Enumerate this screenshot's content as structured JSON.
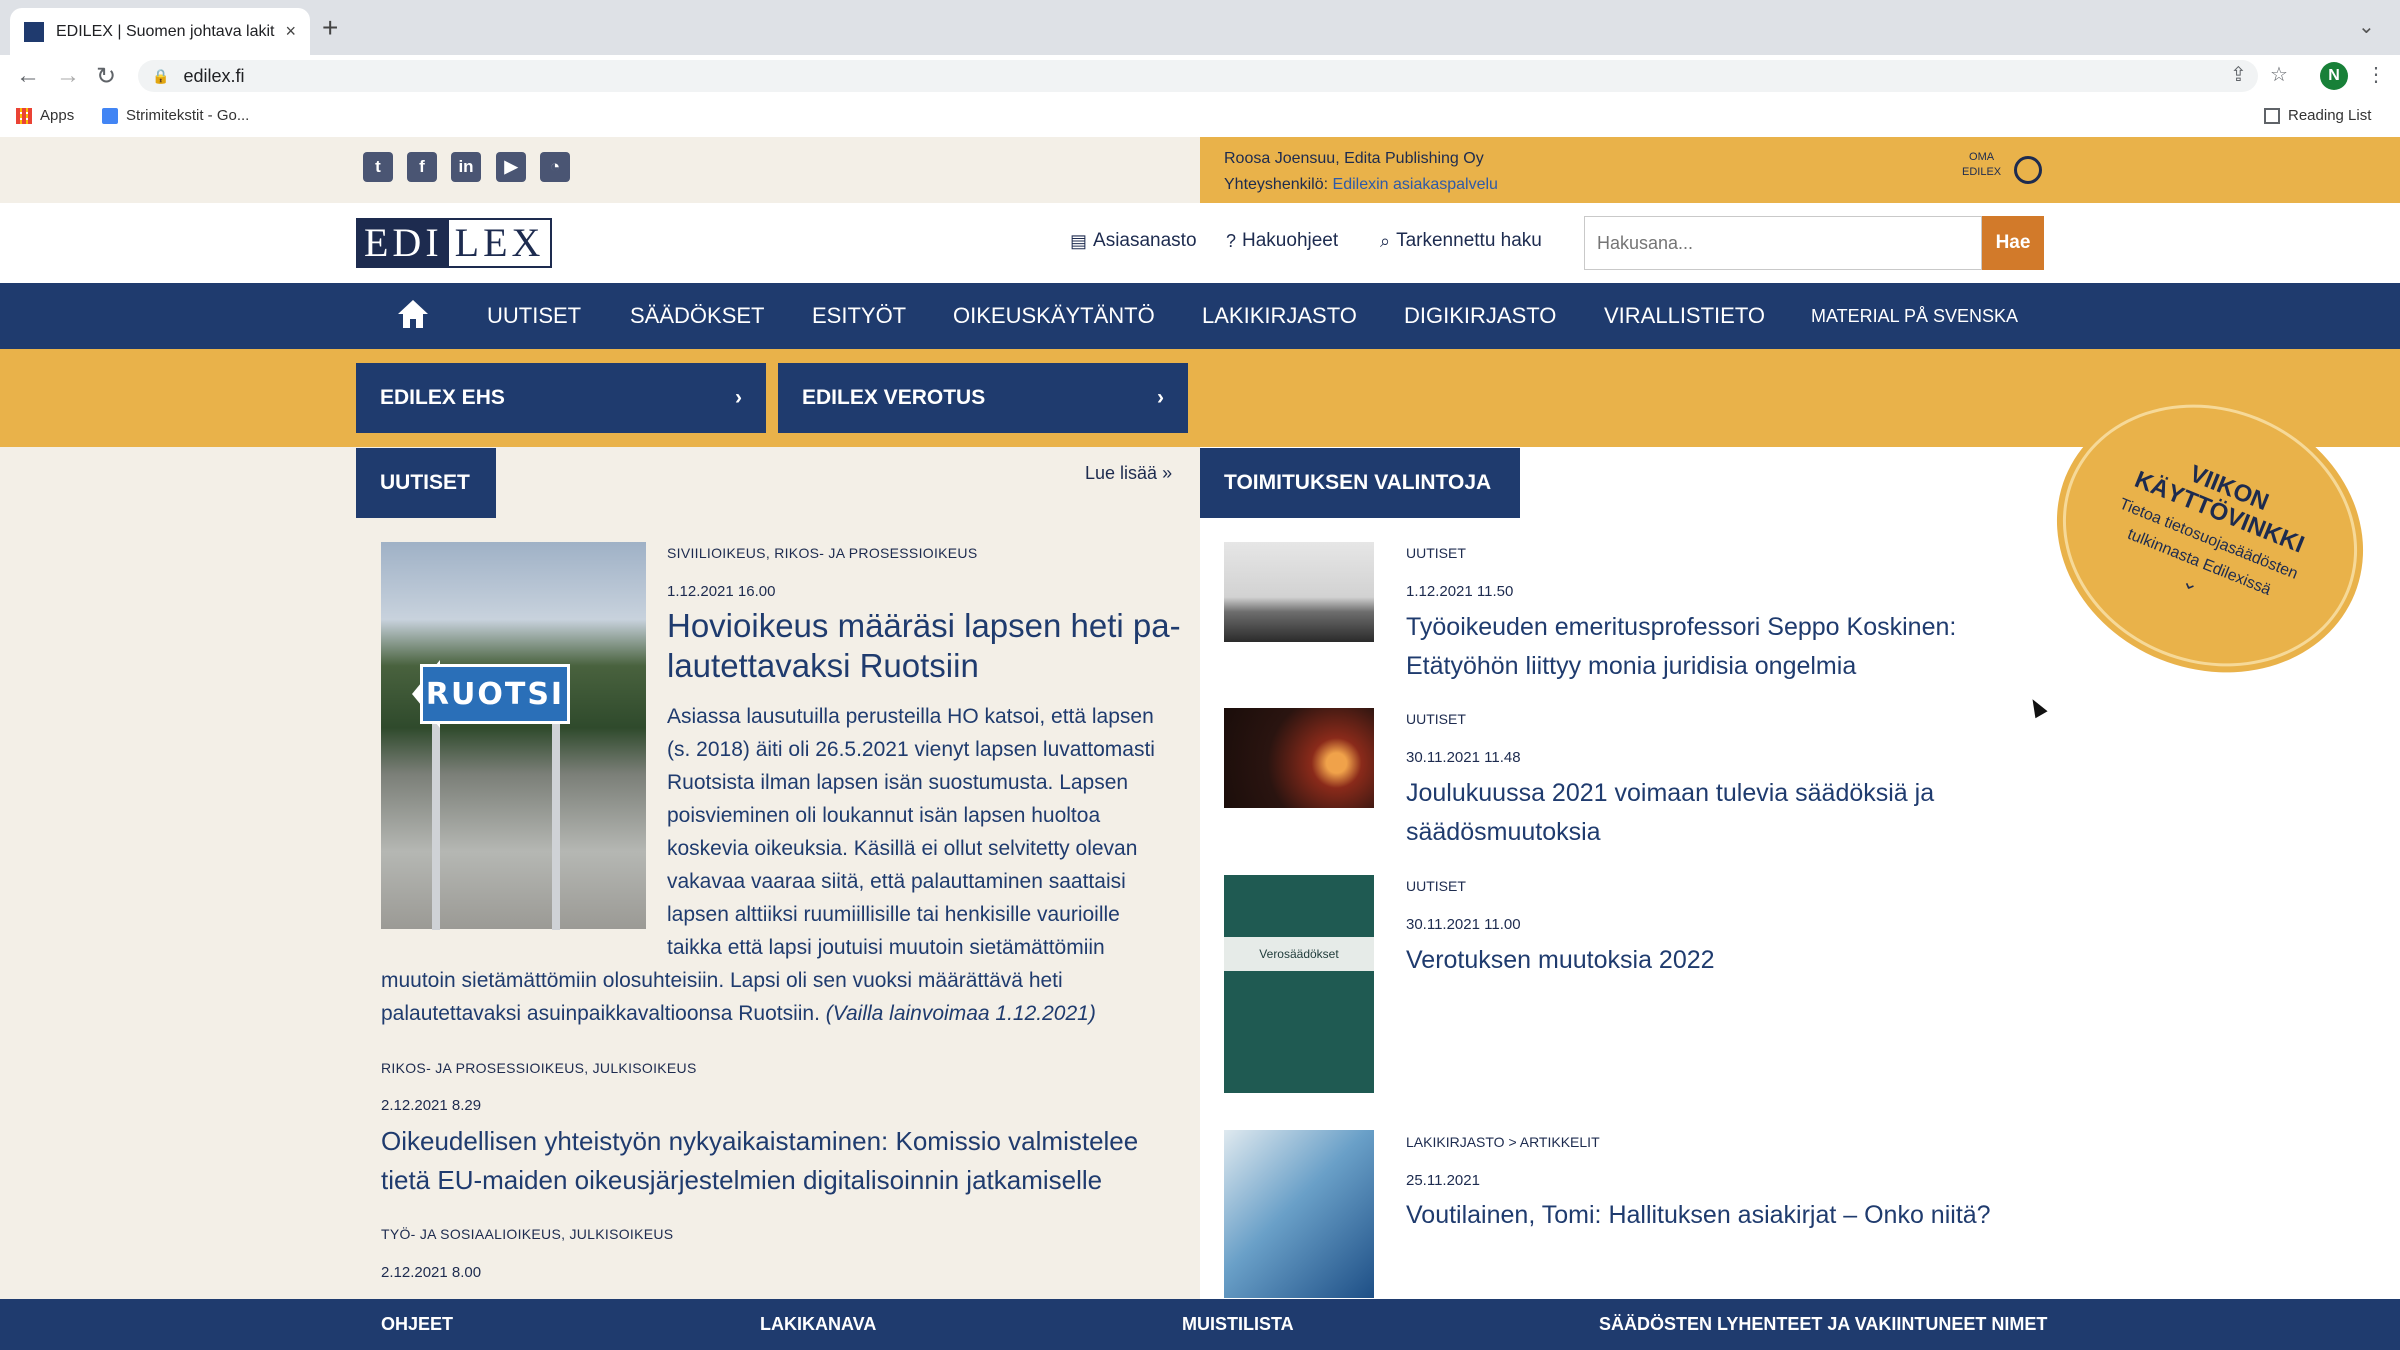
{
  "browser": {
    "tab_title": "EDILEX | Suomen johtava lakit",
    "new_tab": "+",
    "url": "edilex.fi",
    "bookmarks": [
      "Apps",
      "Strimitekstit - Go..."
    ],
    "reading_list": "Reading List",
    "profile_initial": "N"
  },
  "topbar": {
    "social_icons": [
      "twitter-icon",
      "facebook-icon",
      "linkedin-icon",
      "youtube-icon",
      "rss-icon"
    ],
    "user_line": "Roosa Joensuu, Edita Publishing Oy",
    "contact_label": "Yhteyshenkilö:",
    "contact_link": "Edilexin asiakaspalvelu",
    "oma_line1": "OMA",
    "oma_line2": "EDILEX"
  },
  "header": {
    "logo_part1": "EDI",
    "logo_part2": "LEX",
    "links": [
      "Asiasanasto",
      "Hakuohjeet",
      "Tarkennettu haku"
    ],
    "search_placeholder": "Hakusana...",
    "search_button": "Hae"
  },
  "mainnav": {
    "items": [
      "UUTISET",
      "SÄÄDÖKSET",
      "ESITYÖT",
      "OIKEUSKÄYTÄNTÖ",
      "LAKIKIRJASTO",
      "DIGIKIRJASTO",
      "VIRALLISTIETO",
      "MATERIAL PÅ SVENSKA"
    ]
  },
  "promo": {
    "buttons": [
      "EDILEX EHS",
      "EDILEX VEROTUS"
    ]
  },
  "news": {
    "heading": "UUTISET",
    "read_more": "Lue lisää",
    "articles": [
      {
        "category": "SIVIILIOIKEUS, RIKOS- JA PROSESSIOIKEUS",
        "date": "1.12.2021 16.00",
        "title": "Hovioikeus määräsi lapsen heti palautettavaksi Ruotsiin",
        "title_line1": "Hovioikeus määräsi lapsen heti pa-",
        "title_line2": "lautettavaksi Ruotsiin",
        "image_sign": "RUOTSI",
        "body": "Asiassa lausutuilla perusteilla HO katsoi, että lapsen (s. 2018) äiti oli 26.5.2021 vienyt lapsen luvattomasti Ruotsista ilman lapsen isän suostumusta. Lapsen poisvieminen oli loukannut isän lapsen huoltoa koskevia oikeuksia. Käsillä ei ollut selvitetty olevan vakavaa vaaraa siitä, että palauttaminen saattaisi lapsen alttiiksi ruumiillisille tai henkisille vaurioille taikka että lapsi joutuisi muutoin sietämättömiin olosuhteisiin. Lapsi oli sen vuoksi määrättävä heti palautettavaksi asuinpaikkavaltioonsa Ruotsiin.",
        "body_note": "(Vailla lainvoimaa 1.12.2021)"
      },
      {
        "category": "RIKOS- JA PROSESSIOIKEUS, JULKISOIKEUS",
        "date": "2.12.2021 8.29",
        "title_line1": "Oikeudellisen yhteistyön nykyaikaistaminen: Komissio valmistelee",
        "title_line2": "tietä EU-maiden oikeusjärjestelmien digitalisoinnin jatkamiselle"
      },
      {
        "category": "TYÖ- JA SOSIAALIOIKEUS, JULKISOIKEUS",
        "date": "2.12.2021 8.00"
      }
    ]
  },
  "editors": {
    "heading": "TOIMITUKSEN VALINTOJA",
    "items": [
      {
        "category": "UUTISET",
        "date": "1.12.2021 11.50",
        "title_line1": "Työoikeuden emeritusprofessori Seppo Koskinen:",
        "title_line2": "Etätyöhön liittyy monia juridisia ongelmia"
      },
      {
        "category": "UUTISET",
        "date": "30.11.2021 11.48",
        "title_line1": "Joulukuussa 2021 voimaan tulevia säädöksiä ja",
        "title_line2": "säädösmuutoksia"
      },
      {
        "category": "UUTISET",
        "date": "30.11.2021 11.00",
        "title_line1": "Verotuksen muutoksia 2022",
        "title_line2": "",
        "thumb_label": "Verosäädökset"
      },
      {
        "category": "LAKIKIRJASTO > ARTIKKELIT",
        "date": "25.11.2021",
        "title_line1": "Voutilainen, Tomi: Hallituksen asiakirjat – Onko niitä?",
        "title_line2": ""
      }
    ]
  },
  "badge": {
    "line1": "VIIKON",
    "line2": "KÄYTTÖVINKKI",
    "line3": "Tietoa tietosuojasäädösten",
    "line4": "tulkinnasta Edilexissä"
  },
  "footer": {
    "items": [
      "OHJEET",
      "LAKIKANAVA",
      "MUISTILISTA",
      "SÄÄDÖSTEN LYHENTEET JA VAKIINTUNEET NIMET"
    ]
  },
  "colors": {
    "navy": "#1f3b6e",
    "orange": "#e9b24a",
    "search_button": "#d27a2a",
    "cream": "#f3efe7"
  }
}
